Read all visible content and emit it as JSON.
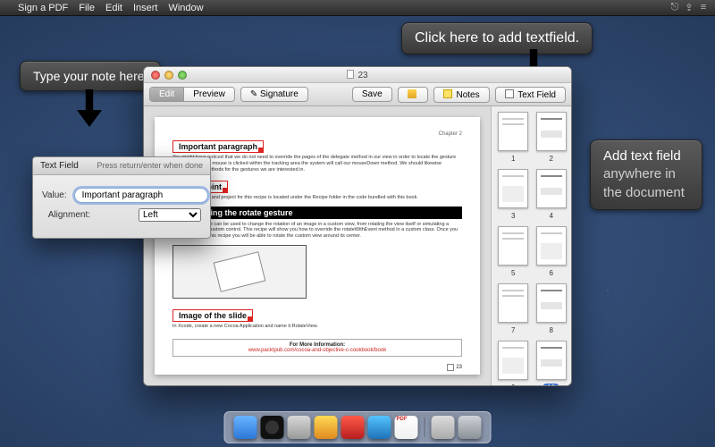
{
  "menubar": {
    "app": "Sign a PDF",
    "items": [
      "File",
      "Edit",
      "Insert",
      "Window"
    ]
  },
  "callouts": {
    "top_left": "Type your note here.",
    "top_right": "Click here to add textfield.",
    "side": "Add text field anywhere in the document"
  },
  "window": {
    "title": "23",
    "toolbar": {
      "edit": "Edit",
      "preview": "Preview",
      "signature": "Signature",
      "save": "Save",
      "notes": "Notes",
      "textfield": "Text Field"
    }
  },
  "doc": {
    "chapter": "Chapter 2",
    "field1": "Important paragraph",
    "para1": "You might have noticed that we do not need to override the pages of the delegate method in our view in order to locate the gesture events. When the mouse is clicked within the tracking area the system will call our mouseDown method. We should likewise implement the methods for the gestures we are interested in.",
    "field2": "Short point",
    "para2": "The sample code and project for this recipe is located under the Recipe folder in the code bundled with this book.",
    "heading": "Interpreting the rotate gesture",
    "para3": "The rotate gesture can be used to change the rotation of an image in a custom view, from rotating the view itself or simulating a rotating dial in a custom control. This recipe will show you how to override the rotateWithEvent method in a custom class. Once you have completed this recipe you will be able to rotate the custom view around its center.",
    "field3": "Image of the slide",
    "para4": "In Xcode, create a new Cocoa Application and name it RotateView.",
    "footer_title": "For More Information:",
    "footer_link": "www.packtpub.com/cocoa-and-objective-c-cookbook/book",
    "pagenum": "23"
  },
  "thumbnails": {
    "count": 12,
    "selected": 10
  },
  "panel": {
    "title": "Text Field",
    "hint": "Press return/enter when done",
    "value_label": "Value:",
    "value": "Important paragraph",
    "align_label": "Alignment:",
    "align_value": "Left"
  },
  "dock": {
    "items": [
      "finder",
      "dashboard",
      "launchpad",
      "app1",
      "app2",
      "app3",
      "signpdf"
    ],
    "right": [
      "papers",
      "trash"
    ]
  }
}
